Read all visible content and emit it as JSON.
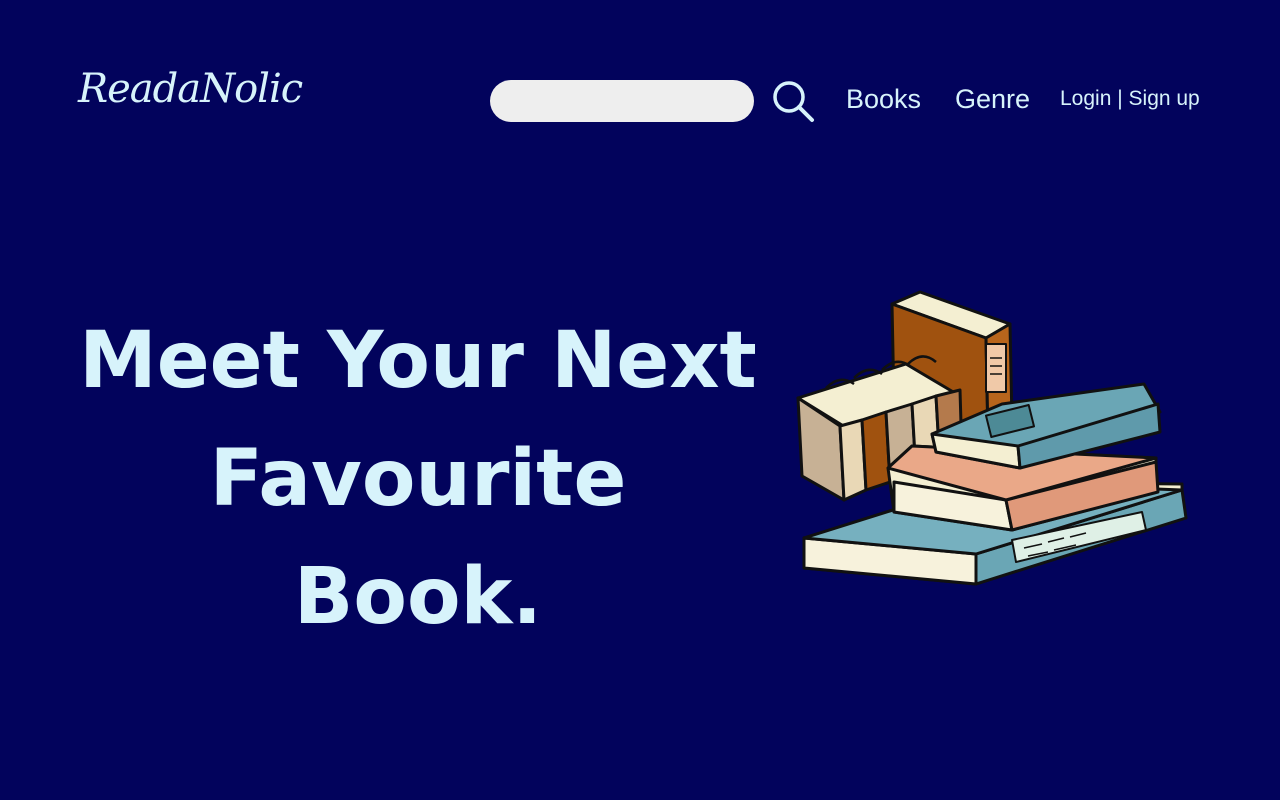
{
  "header": {
    "logo_text": "ReadaNolic",
    "search": {
      "value": "",
      "placeholder": ""
    },
    "search_icon": "search-icon",
    "nav": {
      "books_label": "Books",
      "genre_label": "Genre"
    },
    "auth": {
      "login_label": "Login",
      "separator": " | ",
      "signup_label": "Sign up"
    }
  },
  "hero": {
    "line1": "Meet Your Next",
    "line2": "Favourite Book.",
    "illustration_icon": "book-stack-illustration"
  },
  "colors": {
    "background": "#02035c",
    "text": "#d7f3fb",
    "search_field": "#eeeeee"
  }
}
